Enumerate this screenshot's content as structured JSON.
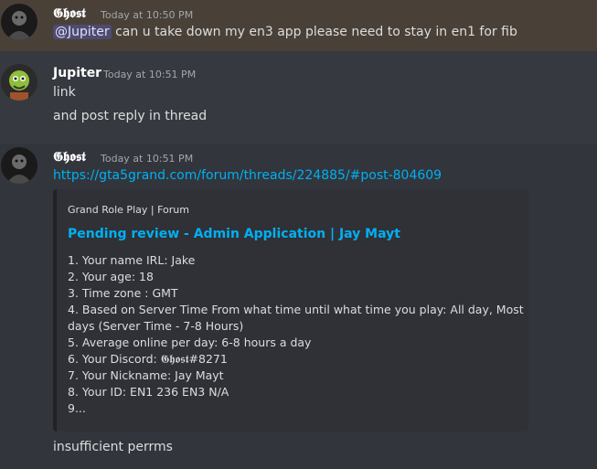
{
  "messages": [
    {
      "author": "𝕲𝖍𝖔𝖘𝖙",
      "timestamp": "Today at 10:50 PM",
      "mention": "@Jupiter",
      "text": " can u take down my en3 app please need to stay in en1 for fib"
    },
    {
      "author": "Jupiter",
      "timestamp": "Today at 10:51 PM",
      "line1": "link",
      "line2": "and post reply in thread"
    },
    {
      "author": "𝕲𝖍𝖔𝖘𝖙",
      "timestamp": "Today at 10:51 PM",
      "link": "https://gta5grand.com/forum/threads/224885/#post-804609",
      "embed": {
        "provider": "Grand Role Play | Forum",
        "title": "Pending review - Admin Application | Jay Mayt",
        "lines": [
          "1. Your name IRL: Jake",
          "2. Your age: 18",
          "3. Time zone : GMT",
          "4. Based on Server Time From what time until what time you play: All day, Most",
          "days (Server Time - 7-8 Hours)",
          "5. Average online per day: 6-8 hours a day",
          "6. Your Discord: 𝕲𝖍𝖔𝖘𝖙#8271",
          "7. Your Nickname: Jay Mayt",
          "8. Your ID: EN1 236 EN3 N/A",
          "9..."
        ]
      },
      "followup": "insufficient perrms"
    }
  ]
}
